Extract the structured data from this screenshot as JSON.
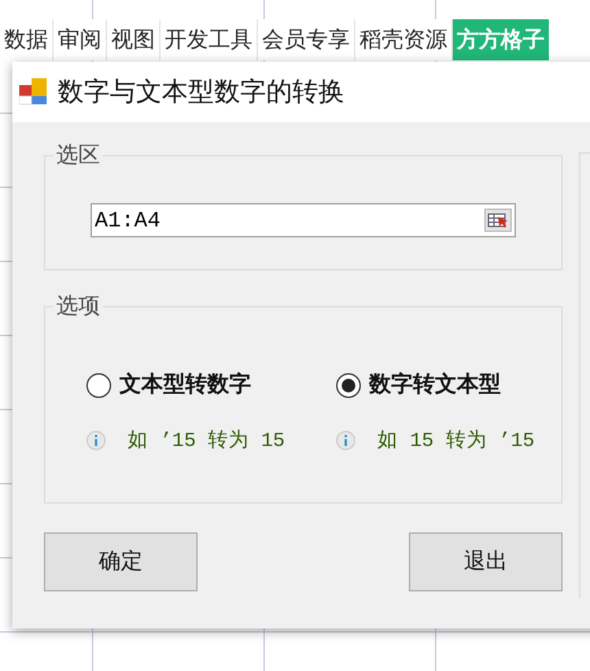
{
  "ribbon_tabs": [
    {
      "label": "数据",
      "selected": false
    },
    {
      "label": "审阅",
      "selected": false
    },
    {
      "label": "视图",
      "selected": false
    },
    {
      "label": "开发工具",
      "selected": false
    },
    {
      "label": "会员专享",
      "selected": false
    },
    {
      "label": "稻壳资源",
      "selected": false
    },
    {
      "label": "方方格子",
      "selected": true
    }
  ],
  "dialog": {
    "title": "数字与文本型数字的转换",
    "selection_group": {
      "label": "选区",
      "range": "A1:A4"
    },
    "options_group": {
      "label": "选项",
      "options": [
        {
          "label": "文本型转数字",
          "selected": false,
          "hint": "如 ’15 转为 15"
        },
        {
          "label": "数字转文本型",
          "selected": true,
          "hint": "如 15 转为 ’15"
        }
      ]
    },
    "buttons": [
      "确定",
      "退出"
    ]
  }
}
